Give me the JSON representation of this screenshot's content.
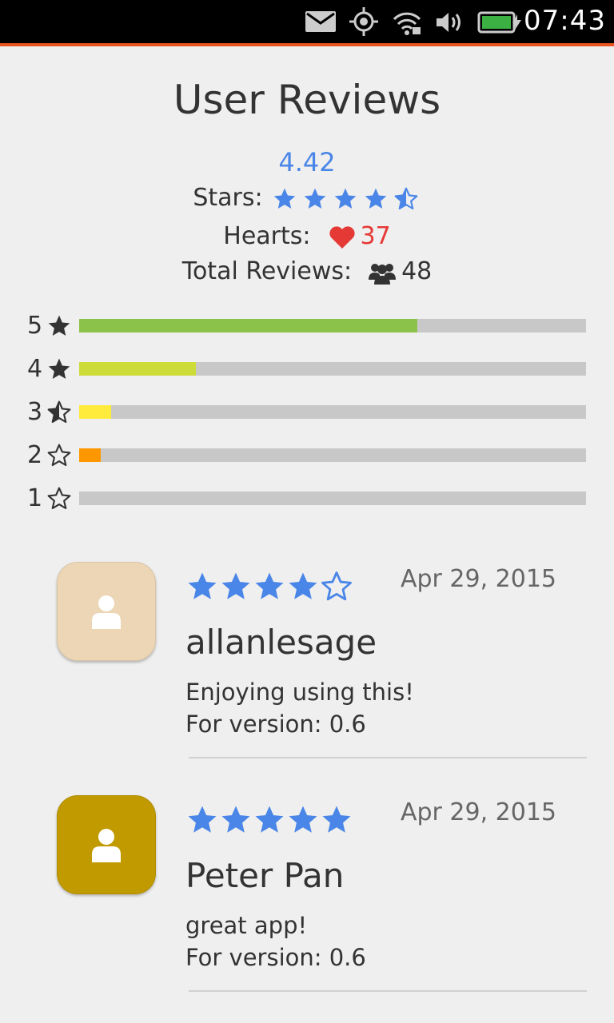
{
  "status_bar": {
    "time": "07:43",
    "icons": [
      "mail-icon",
      "location-icon",
      "wifi-icon",
      "volume-icon",
      "battery-icon"
    ]
  },
  "header": {
    "title": "User Reviews"
  },
  "summary": {
    "average": "4.42",
    "stars_label": "Stars:",
    "stars_value": 4.42,
    "hearts_label": "Hearts:",
    "hearts_value": "37",
    "total_label": "Total Reviews:",
    "total_value": "48"
  },
  "histogram": [
    {
      "label": "5",
      "star": "full",
      "fraction": 0.667,
      "color": "#8bc34a"
    },
    {
      "label": "4",
      "star": "full",
      "fraction": 0.23,
      "color": "#cddc39"
    },
    {
      "label": "3",
      "star": "half",
      "fraction": 0.063,
      "color": "#ffeb3b"
    },
    {
      "label": "2",
      "star": "empty",
      "fraction": 0.042,
      "color": "#ff9800"
    },
    {
      "label": "1",
      "star": "empty",
      "fraction": 0.0,
      "color": "#f44336"
    }
  ],
  "reviews": [
    {
      "rating": 4,
      "date": "Apr 29, 2015",
      "name": "allanlesage",
      "body": "Enjoying using this!",
      "version": "For version: 0.6",
      "avatar_color": "#ecd6b5"
    },
    {
      "rating": 5,
      "date": "Apr 29, 2015",
      "name": "Peter Pan",
      "body": "great app!",
      "version": "For version: 0.6",
      "avatar_color": "#c19a00"
    }
  ],
  "colors": {
    "accent": "#e95420",
    "star_blue": "#4a86e8",
    "heart_red": "#e53935"
  }
}
